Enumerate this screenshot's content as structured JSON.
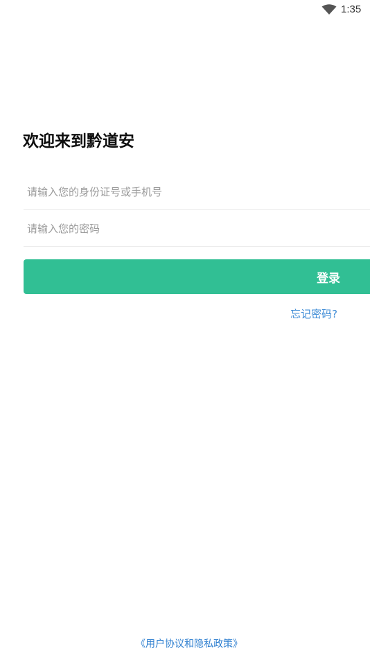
{
  "status_bar": {
    "time": "1:35",
    "wifi_icon": "wifi-icon"
  },
  "login": {
    "title": "欢迎来到黔道安",
    "id_placeholder": "请输入您的身份证号或手机号",
    "password_placeholder": "请输入您的密码",
    "login_label": "登录",
    "forgot_label": "忘记密码?",
    "agreement_label": "《用户协议和隐私政策》"
  },
  "colors": {
    "accent": "#31bf94",
    "link": "#3d8bd6"
  }
}
